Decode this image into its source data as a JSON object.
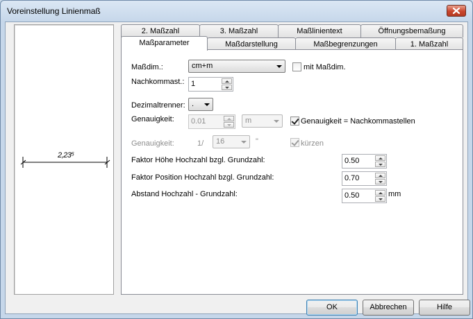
{
  "window": {
    "title": "Voreinstellung Linienmaß"
  },
  "preview": {
    "dimension_text": "2,23⁵"
  },
  "tabs_back": [
    "2. Maßzahl",
    "3. Maßzahl",
    "Maßlinientext",
    "Öffnungsbemaßung"
  ],
  "tabs_front": [
    "Maßparameter",
    "Maßdarstellung",
    "Maßbegrenzungen",
    "1. Maßzahl"
  ],
  "active_tab": "Maßparameter",
  "form": {
    "massdim_label": "Maßdim.:",
    "massdim_value": "cm+m",
    "mit_massdim_label": "mit Maßdim.",
    "nachkommast_label": "Nachkommast.:",
    "nachkommast_value": "1",
    "dezimaltrenner_label": "Dezimaltrenner:",
    "dezimaltrenner_value": ".",
    "genauigkeit_label": "Genauigkeit:",
    "genauigkeit_value": "0.01",
    "genauigkeit_unit": "m",
    "genauigkeit_check_label": "Genauigkeit = Nachkommastellen",
    "genauigkeit2_label": "Genauigkeit:",
    "genauigkeit2_prefix": "1/",
    "genauigkeit2_value": "16",
    "genauigkeit2_unit": "\"",
    "kuerzen_label": "kürzen",
    "faktor_hoehe_label": "Faktor Höhe Hochzahl bzgl. Grundzahl:",
    "faktor_hoehe_value": "0.50",
    "faktor_position_label": "Faktor Position Hochzahl bzgl. Grundzahl:",
    "faktor_position_value": "0.70",
    "abstand_label": "Abstand Hochzahl - Grundzahl:",
    "abstand_value": "0.50",
    "abstand_unit": "mm"
  },
  "buttons": {
    "ok": "OK",
    "abbrechen": "Abbrechen",
    "hilfe": "Hilfe"
  },
  "colors": {
    "accent": "#3c7fb1",
    "close": "#c9452d"
  },
  "icons": {
    "close": "close-icon",
    "dropdown": "chevron-down-icon",
    "spin": "spin-arrows-icon",
    "check": "check-icon"
  }
}
